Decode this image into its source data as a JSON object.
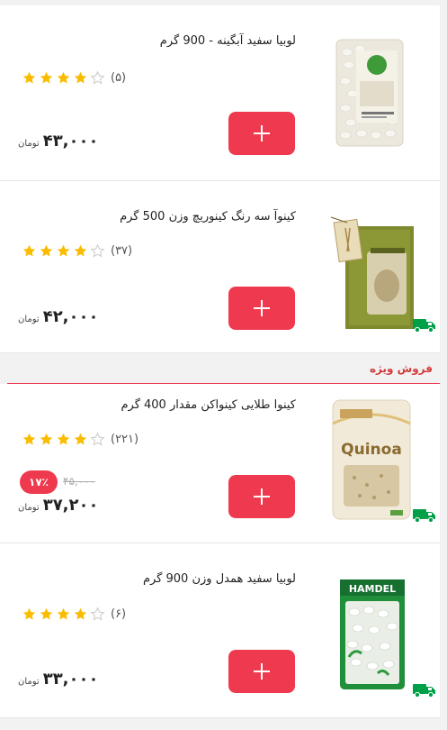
{
  "products": [
    {
      "title": "لوبیا سفید آبگینه - 900 گرم",
      "rating_count": "(۵)",
      "rating": 4,
      "price": "۴۳,۰۰۰",
      "currency": "تومان",
      "add_label": "+",
      "express_delivery": false,
      "image": "white-beans-package"
    },
    {
      "title": "کینوآ سه رنگ کینوریچ وزن 500 گرم",
      "rating_count": "(۳۷)",
      "rating": 4,
      "price": "۴۲,۰۰۰",
      "currency": "تومان",
      "add_label": "+",
      "express_delivery": true,
      "image": "quinoa-paper-bag"
    },
    {
      "title": "کینوا طلایی کینواکن مقدار 400 گرم",
      "rating_count": "(۲۲۱)",
      "rating": 4,
      "price": "۳۷,۲۰۰",
      "old_price": "۴۵,۰۰۰",
      "discount": "۱۷٪",
      "currency": "تومان",
      "add_label": "+",
      "express_delivery": true,
      "image": "quinoa-pouch",
      "image_text": "Quinoa"
    },
    {
      "title": "لوبیا سفید همدل وزن 900 گرم",
      "rating_count": "(۶)",
      "rating": 4,
      "price": "۳۳,۰۰۰",
      "currency": "تومان",
      "add_label": "+",
      "express_delivery": true,
      "image": "white-beans-hamdel",
      "image_text": "HAMDEL"
    }
  ],
  "special_sale_label": "فروش ویژه",
  "colors": {
    "accent": "#ef394e",
    "star": "#f9bc00",
    "star_empty": "#cfcfcf",
    "truck": "#00a049",
    "special": "#d23b3b"
  }
}
